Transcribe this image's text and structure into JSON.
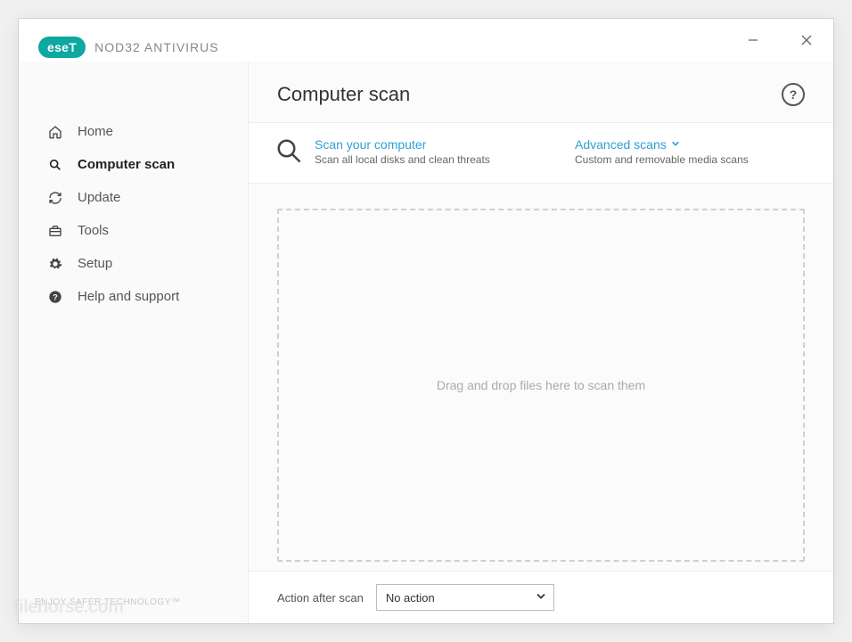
{
  "brand": {
    "logo_text": "eseT",
    "product": "NOD32 ANTIVIRUS"
  },
  "sidebar": {
    "items": [
      {
        "label": "Home",
        "icon": "home-icon",
        "active": false
      },
      {
        "label": "Computer scan",
        "icon": "search-icon",
        "active": true
      },
      {
        "label": "Update",
        "icon": "refresh-icon",
        "active": false
      },
      {
        "label": "Tools",
        "icon": "briefcase-icon",
        "active": false
      },
      {
        "label": "Setup",
        "icon": "gear-icon",
        "active": false
      },
      {
        "label": "Help and support",
        "icon": "help-solid-icon",
        "active": false
      }
    ],
    "footer": "ENJOY SAFER TECHNOLOGY™"
  },
  "header": {
    "title": "Computer scan"
  },
  "options": {
    "scan": {
      "title": "Scan your computer",
      "sub": "Scan all local disks and clean threats"
    },
    "advanced": {
      "title": "Advanced scans",
      "sub": "Custom and removable media scans"
    }
  },
  "dropzone": {
    "text": "Drag and drop files here to scan them"
  },
  "bottom": {
    "label": "Action after scan",
    "selected": "No action"
  },
  "watermark": "filehorse.com"
}
